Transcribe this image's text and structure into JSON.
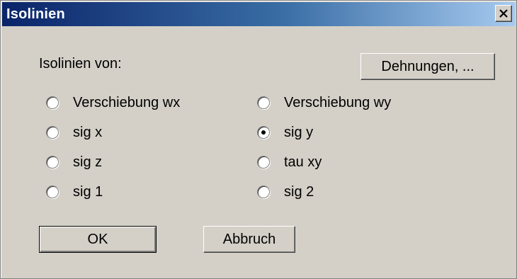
{
  "window": {
    "title": "Isolinien",
    "close_symbol": "×"
  },
  "content": {
    "label": "Isolinien von:",
    "dehnungen_button": "Dehnungen, ...",
    "options": [
      {
        "label": "Verschiebung wx",
        "checked": false
      },
      {
        "label": "Verschiebung wy",
        "checked": false
      },
      {
        "label": "sig x",
        "checked": false
      },
      {
        "label": "sig y",
        "checked": true
      },
      {
        "label": "sig z",
        "checked": false
      },
      {
        "label": "tau xy",
        "checked": false
      },
      {
        "label": "sig 1",
        "checked": false
      },
      {
        "label": "sig 2",
        "checked": false
      }
    ],
    "ok_button": "OK",
    "cancel_button": "Abbruch"
  },
  "colors": {
    "face": "#d4d0c8",
    "title_gradient_start": "#0a246a",
    "title_gradient_end": "#a6caf0"
  }
}
